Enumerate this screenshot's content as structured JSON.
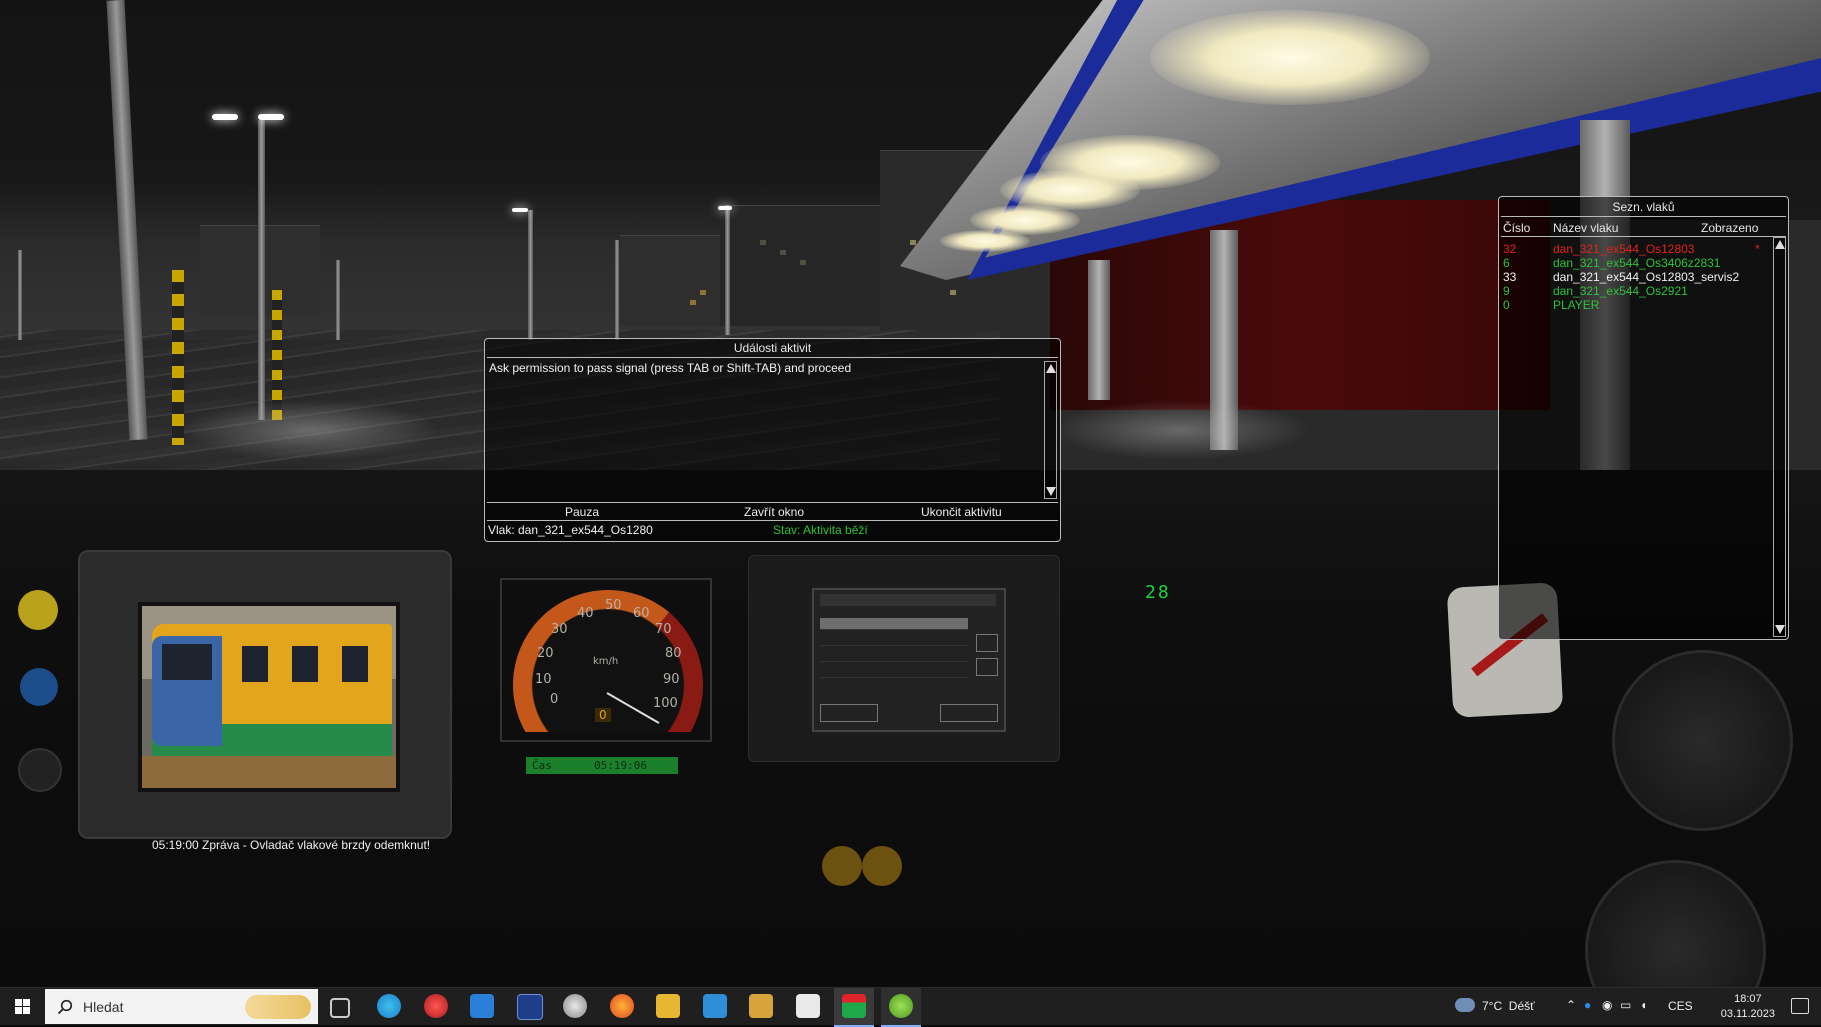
{
  "activity_window": {
    "title": "Události aktivit",
    "message": "Ask permission to pass signal (press TAB or Shift-TAB) and proceed",
    "buttons": {
      "pause": "Pauza",
      "close": "Zavřít okno",
      "end": "Ukončit aktivitu"
    },
    "train_label": "Vlak: dan_321_ex544_Os1280",
    "status_label": "Stav: Aktivita běží"
  },
  "train_list": {
    "title": "Sezn. vlaků",
    "headers": {
      "number": "Číslo",
      "name": "Název vlaku",
      "shown": "Zobrazeno"
    },
    "rows": [
      {
        "number": "32",
        "name": "dan_321_ex544_Os12803",
        "shown": "*",
        "color": "#e0241b"
      },
      {
        "number": "6",
        "name": "dan_321_ex544_Os3406z2831",
        "shown": "",
        "color": "#2fc23a"
      },
      {
        "number": "33",
        "name": "dan_321_ex544_Os12803_servis2",
        "shown": "",
        "color": "#f0f0f0"
      },
      {
        "number": "9",
        "name": "dan_321_ex544_Os2921",
        "shown": "",
        "color": "#2fc23a"
      },
      {
        "number": "0",
        "name": "PLAYER",
        "shown": "",
        "color": "#2fc23a"
      }
    ]
  },
  "cab": {
    "message": "05:19:00 Zpráva - Ovladač vlakové brzdy odemknut!",
    "clock_label": "Čas",
    "clock_time": "05:19:06",
    "digital_display": "28",
    "speed_unit": "km/h",
    "speed_value": "0",
    "speedo_ticks": [
      "0",
      "10",
      "20",
      "30",
      "40",
      "50",
      "60",
      "70",
      "80",
      "90",
      "100"
    ]
  },
  "taskbar": {
    "search_placeholder": "Hledat",
    "weather": "7°C  Déšť",
    "language": "CES",
    "time": "18:07",
    "date": "03.11.2023",
    "apps": [
      "task-view-icon",
      "edge-icon",
      "game-icon",
      "store-icon",
      "monitor-icon",
      "steam-icon",
      "firefox-icon",
      "explorer-icon",
      "camera-icon",
      "folder-paint-icon",
      "notepad-icon",
      "train-app-icon",
      "green-app-icon"
    ],
    "colors": {
      "accent_green": "#2fc23a",
      "accent_red": "#e0241b",
      "canopy_blue": "#1b2b9a"
    }
  }
}
